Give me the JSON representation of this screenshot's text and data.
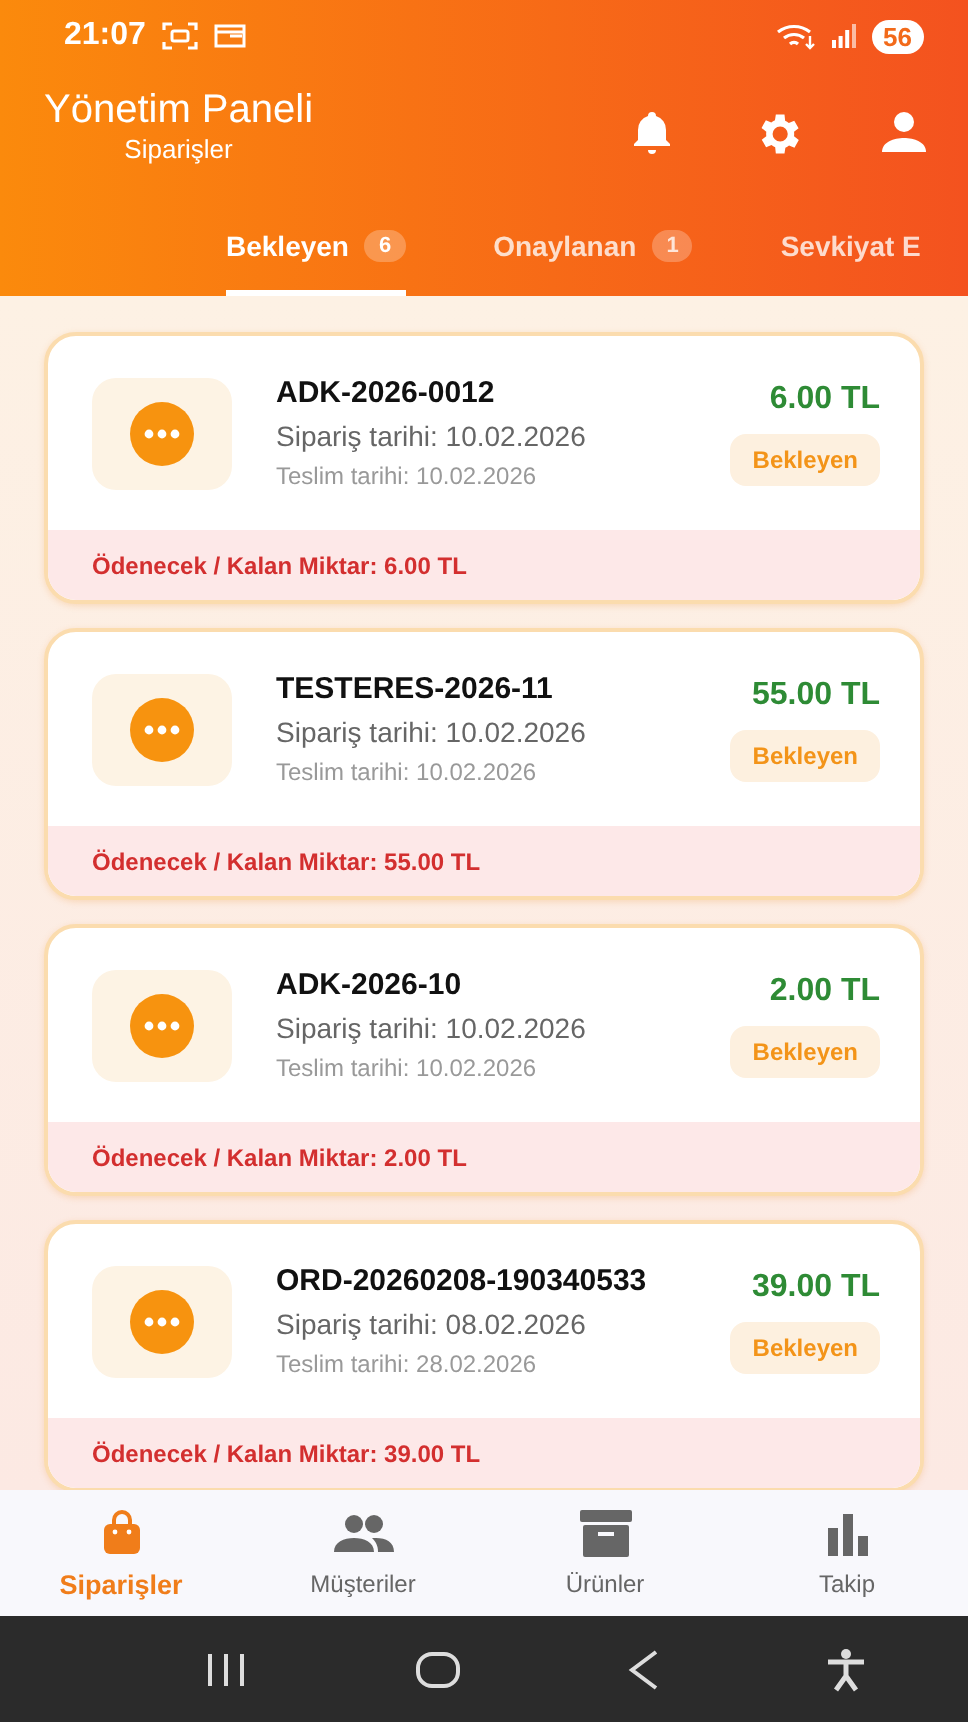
{
  "status_bar": {
    "time": "21:07",
    "battery": "56"
  },
  "header": {
    "title": "Yönetim Paneli",
    "subtitle": "Siparişler"
  },
  "tabs": [
    {
      "label": "Bekleyen",
      "count": "6",
      "selected": true
    },
    {
      "label": "Onaylanan",
      "count": "1",
      "selected": false
    },
    {
      "label": "Sevkiyat E",
      "selected": false
    }
  ],
  "orders": [
    {
      "code": "ADK-2026-0012",
      "order_date": "Sipariş tarihi: 10.02.2026",
      "delivery_date": "Teslim tarihi: 10.02.2026",
      "amount": "6.00 TL",
      "status": "Bekleyen",
      "balance": "Ödenecek / Kalan Miktar: 6.00 TL"
    },
    {
      "code": "TESTERES-2026-11",
      "order_date": "Sipariş tarihi: 10.02.2026",
      "delivery_date": "Teslim tarihi: 10.02.2026",
      "amount": "55.00 TL",
      "status": "Bekleyen",
      "balance": "Ödenecek / Kalan Miktar: 55.00 TL"
    },
    {
      "code": "ADK-2026-10",
      "order_date": "Sipariş tarihi: 10.02.2026",
      "delivery_date": "Teslim tarihi: 10.02.2026",
      "amount": "2.00 TL",
      "status": "Bekleyen",
      "balance": "Ödenecek / Kalan Miktar: 2.00 TL"
    },
    {
      "code": "ORD-20260208-190340533",
      "order_date": "Sipariş tarihi: 08.02.2026",
      "delivery_date": "Teslim tarihi: 28.02.2026",
      "amount": "39.00 TL",
      "status": "Bekleyen",
      "balance": "Ödenecek / Kalan Miktar: 39.00 TL"
    }
  ],
  "bottom_nav": [
    {
      "label": "Siparişler",
      "kind": "bag",
      "selected": true
    },
    {
      "label": "Müşteriler",
      "kind": "people",
      "selected": false
    },
    {
      "label": "Ürünler",
      "kind": "box",
      "selected": false
    },
    {
      "label": "Takip",
      "kind": "chart",
      "selected": false
    }
  ]
}
